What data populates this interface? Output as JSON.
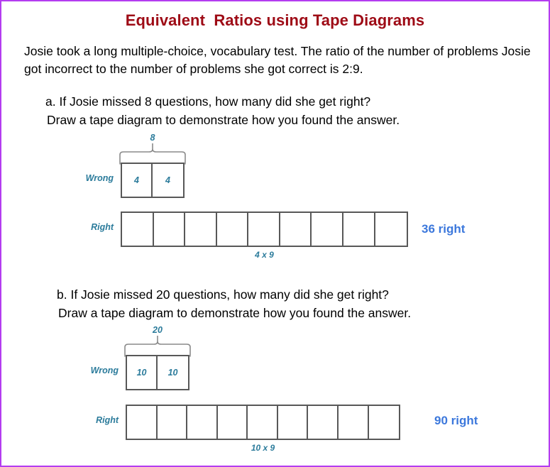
{
  "page": {
    "border_color": "#b43cf0",
    "background": "#ffffff"
  },
  "header": {
    "title": "Equivalent  Ratios using Tape Diagrams",
    "title_color": "#9e0b16"
  },
  "intro": {
    "text": "Josie took a long multiple-choice, vocabulary test. The ratio of the number of problems Josie got incorrect to the number of problems she got correct is 2:9."
  },
  "parts": [
    {
      "id": "a",
      "question": "a. If Josie missed 8 questions, how many did she get right?",
      "instruction": "Draw a tape diagram to demonstrate how you found the answer.",
      "wrong": {
        "label": "Wrong",
        "brace_label": "8",
        "cells": [
          "4",
          "4"
        ]
      },
      "right": {
        "label": "Right",
        "cells": [
          "",
          "",
          "",
          "",
          "",
          "",
          "",
          "",
          ""
        ],
        "under_label": "4 x 9"
      },
      "answer": "36 right",
      "answer_color": "#3c78dc"
    },
    {
      "id": "b",
      "question": "b. If Josie missed 20 questions, how many did she get right?",
      "instruction": "Draw a tape diagram to demonstrate how you found the answer.",
      "wrong": {
        "label": "Wrong",
        "brace_label": "20",
        "cells": [
          "10",
          "10"
        ]
      },
      "right": {
        "label": "Right",
        "cells": [
          "",
          "",
          "",
          "",
          "",
          "",
          "",
          "",
          ""
        ],
        "under_label": "10 x 9"
      },
      "answer": "90 right",
      "answer_color": "#3c78dc"
    }
  ],
  "colors": {
    "tape_stroke": "#585858",
    "label_teal": "#2b7b9b",
    "answer_blue": "#3c78dc",
    "brace_gray": "#8a8a8a"
  }
}
